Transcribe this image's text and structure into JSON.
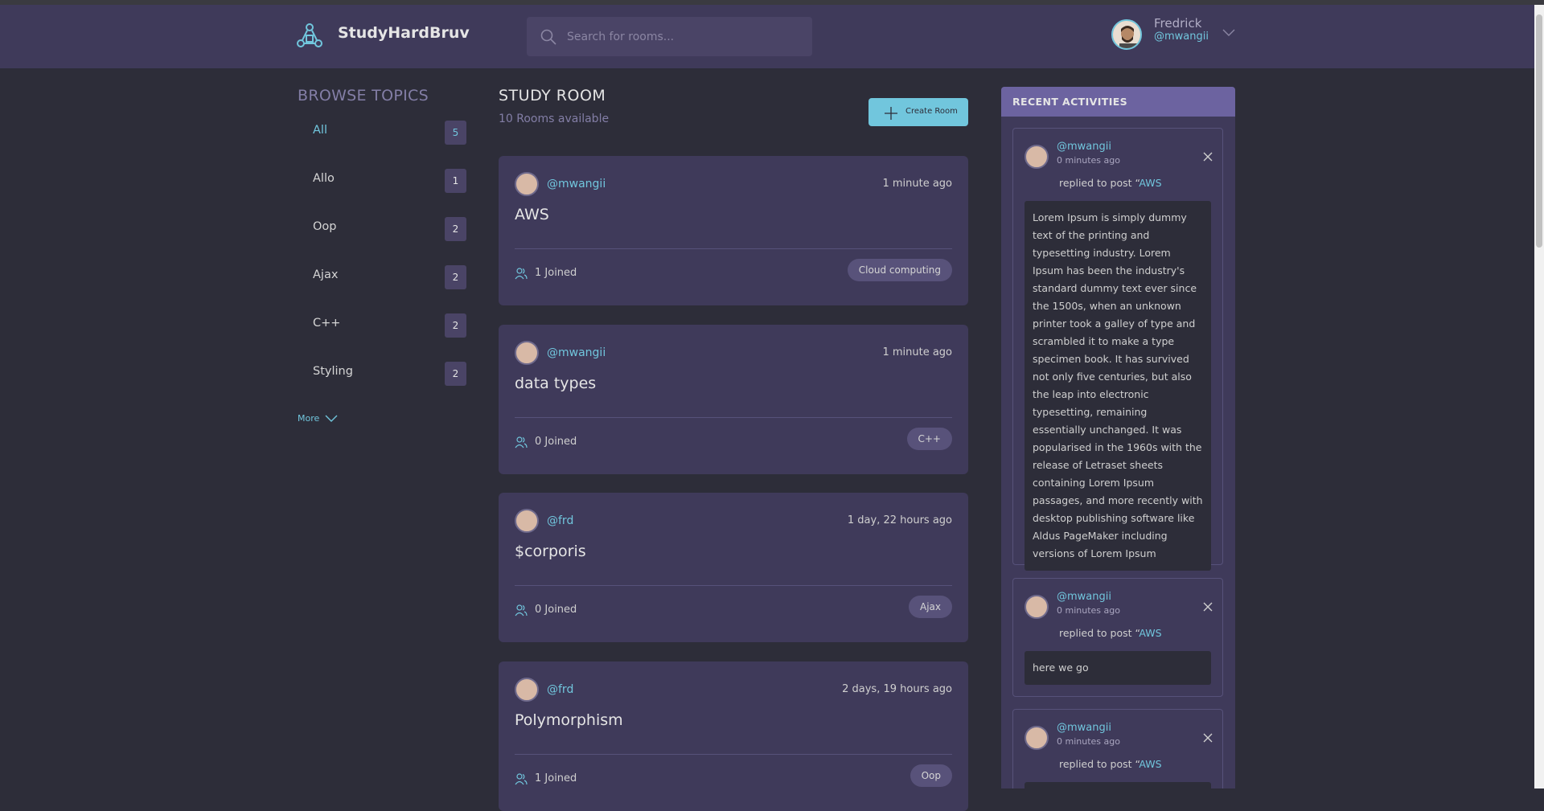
{
  "header": {
    "brand": "StudyHardBruv",
    "search_placeholder": "Search for rooms...",
    "user_name": "Fredrick",
    "user_handle": "@mwangii"
  },
  "sidebar": {
    "title": "BROWSE TOPICS",
    "topics": [
      {
        "name": "All",
        "count": "5"
      },
      {
        "name": "Allo",
        "count": "1"
      },
      {
        "name": "Oop",
        "count": "2"
      },
      {
        "name": "Ajax",
        "count": "2"
      },
      {
        "name": "C++",
        "count": "2"
      },
      {
        "name": "Styling",
        "count": "2"
      }
    ],
    "more_label": "More"
  },
  "main": {
    "title": "STUDY ROOM",
    "rooms_available": "10 Rooms available",
    "create_label": "Create Room",
    "rooms": [
      {
        "host": "@mwangii",
        "time": "1 minute ago",
        "name": "AWS",
        "joined": "1 Joined",
        "topic": "Cloud computing"
      },
      {
        "host": "@mwangii",
        "time": "1 minute ago",
        "name": "data types",
        "joined": "0 Joined",
        "topic": "C++"
      },
      {
        "host": "@frd",
        "time": "1 day, 22 hours ago",
        "name": "$corporis",
        "joined": "0 Joined",
        "topic": "Ajax"
      },
      {
        "host": "@frd",
        "time": "2 days, 19 hours ago",
        "name": "Polymorphism",
        "joined": "1 Joined",
        "topic": "Oop"
      }
    ]
  },
  "activities": {
    "title": "RECENT ACTIVITIES",
    "items": [
      {
        "handle": "@mwangii",
        "time": "0 minutes ago",
        "reply_prefix": "replied to post “",
        "post": "AWS",
        "body": "Lorem Ipsum is simply dummy text of the printing and typesetting industry. Lorem Ipsum has been the industry's standard dummy text ever since the 1500s, when an unknown printer took a galley of type and scrambled it to make a type specimen book. It has survived not only five centuries, but also the leap into electronic typesetting, remaining essentially unchanged. It was popularised in the 1960s with the release of Letraset sheets containing Lorem Ipsum passages, and more recently with desktop publishing software like Aldus PageMaker including versions of Lorem Ipsum"
      },
      {
        "handle": "@mwangii",
        "time": "0 minutes ago",
        "reply_prefix": "replied to post “",
        "post": "AWS",
        "body": "here we go"
      },
      {
        "handle": "@mwangii",
        "time": "0 minutes ago",
        "reply_prefix": "replied to post “",
        "post": "AWS",
        "body": ""
      }
    ]
  },
  "colors": {
    "accent": "#71c6dd",
    "background": "#2d2d39",
    "panel": "#3f3a5a",
    "activities_header": "#6c63a0"
  }
}
